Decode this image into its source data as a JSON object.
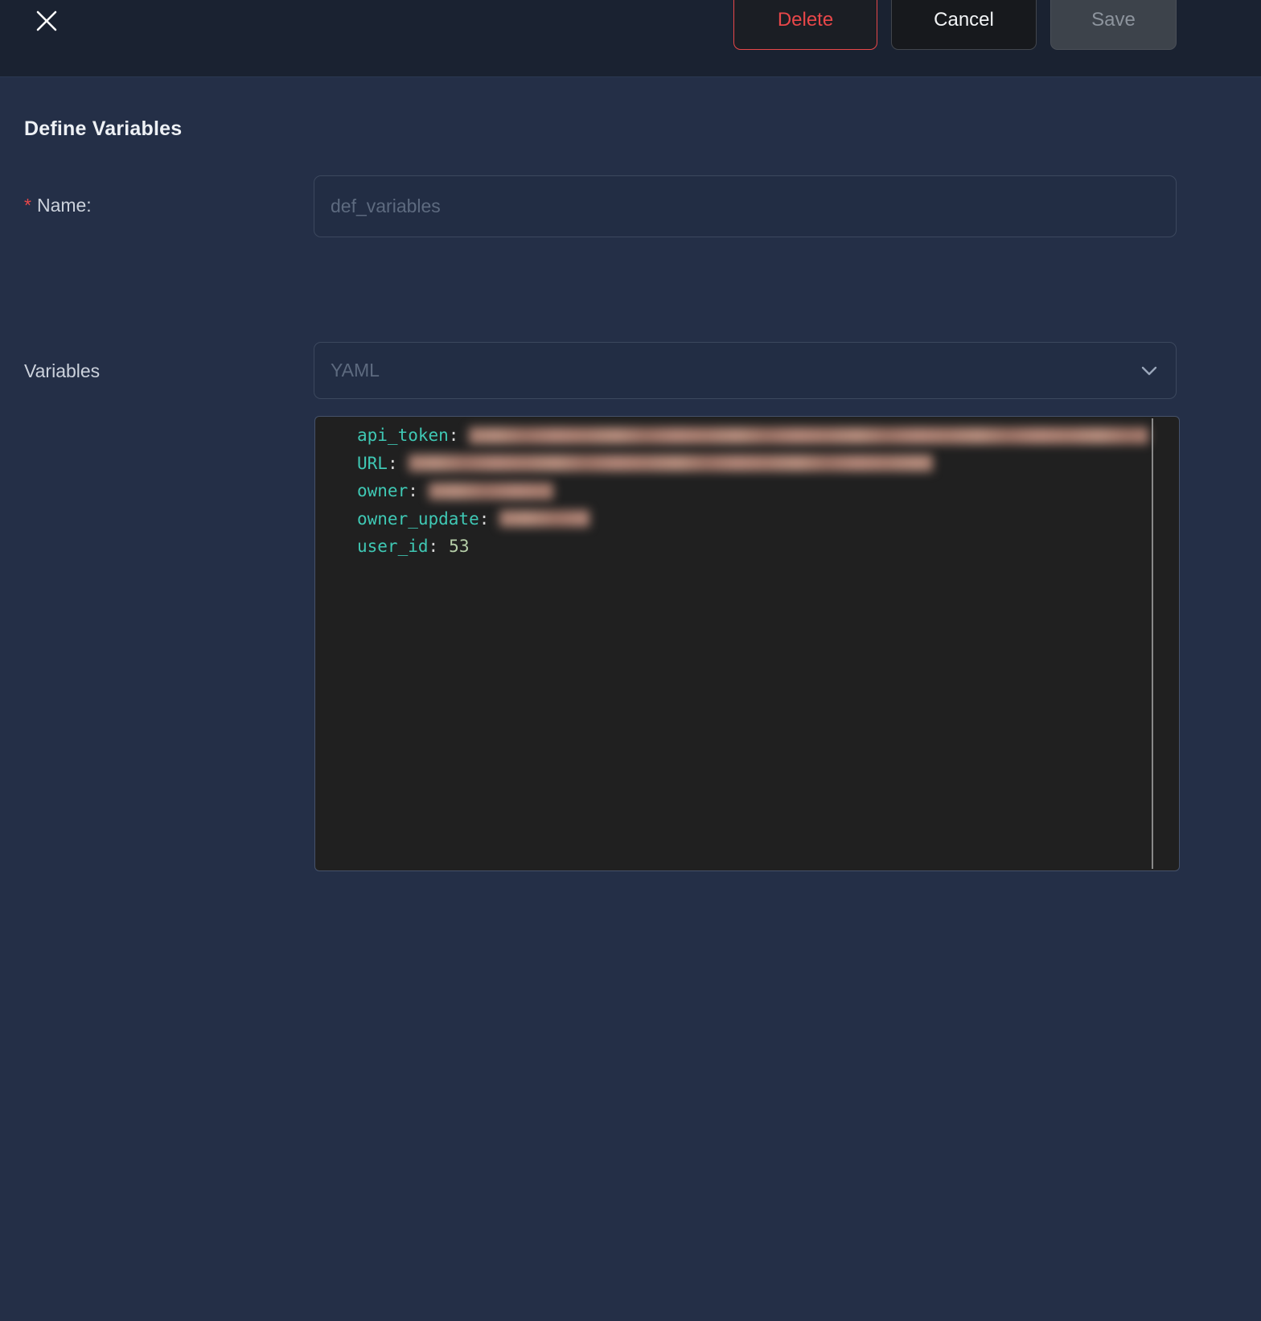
{
  "header": {
    "buttons": {
      "delete": "Delete",
      "cancel": "Cancel",
      "save": "Save"
    }
  },
  "form": {
    "title": "Define Variables",
    "name": {
      "required_marker": "*",
      "label": "Name:",
      "placeholder": "def_variables",
      "value": ""
    },
    "variables": {
      "label": "Variables",
      "format_value": "YAML"
    }
  },
  "editor": {
    "language": "YAML",
    "lines": [
      {
        "key": "api_token",
        "colon": ":",
        "redacted": true,
        "redact_width": 845,
        "value": ""
      },
      {
        "key": "URL",
        "colon": ":",
        "redacted": true,
        "redact_width": 652,
        "value": ""
      },
      {
        "key": "owner",
        "colon": ":",
        "redacted": true,
        "redact_width": 155,
        "value": ""
      },
      {
        "key": "owner_update",
        "colon": ":",
        "redacted": true,
        "redact_width": 112,
        "value": ""
      },
      {
        "key": "user_id",
        "colon": ":",
        "redacted": false,
        "redact_width": 0,
        "value": "53"
      }
    ]
  },
  "colors": {
    "accent_red": "#e84749",
    "code_key_teal": "#3fc8b4",
    "code_value_green": "#b5cea8",
    "redaction_tone": "#ab8171",
    "header_bg": "#1a2231",
    "body_bg": "#242f47",
    "editor_bg": "#202020"
  }
}
